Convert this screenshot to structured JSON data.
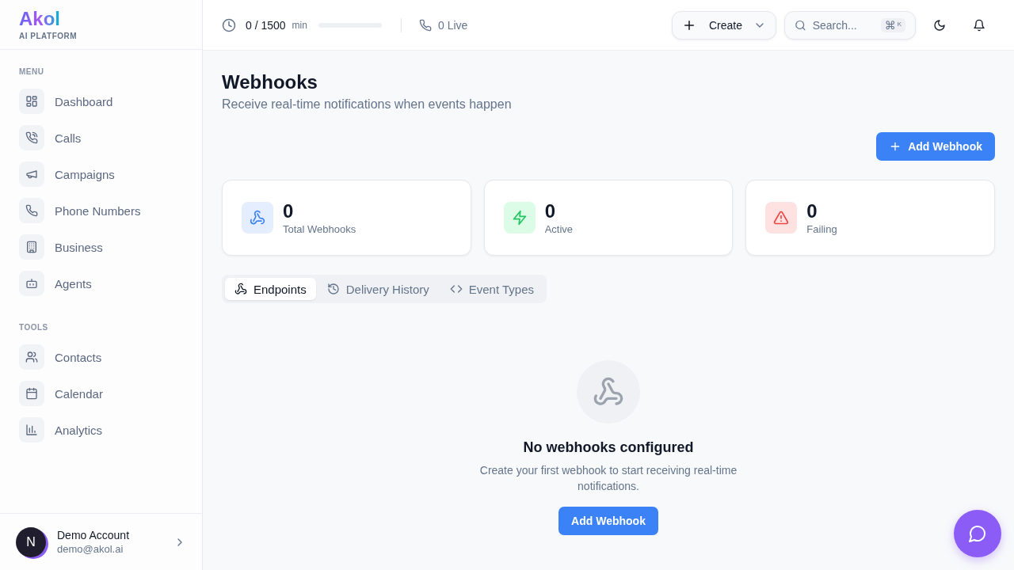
{
  "brand": {
    "name": "Akol",
    "tagline": "AI PLATFORM"
  },
  "header": {
    "usage": {
      "value": "0 / 1500",
      "unit": "min",
      "level": 0
    },
    "live": "0 Live",
    "create_button": "Create",
    "search": {
      "placeholder": "Search...",
      "shortcut_symbol": "⌘",
      "shortcut_key": "K"
    }
  },
  "sidebar": {
    "sections": [
      {
        "heading": "MENU",
        "items": [
          {
            "label": "Dashboard",
            "selected": false
          },
          {
            "label": "Calls",
            "selected": false
          },
          {
            "label": "Campaigns",
            "selected": false
          },
          {
            "label": "Phone Numbers",
            "selected": false
          },
          {
            "label": "Business",
            "selected": false
          },
          {
            "label": "Agents",
            "selected": false
          }
        ]
      },
      {
        "heading": "TOOLS",
        "items": [
          {
            "label": "Contacts",
            "selected": false
          },
          {
            "label": "Calendar",
            "selected": false
          },
          {
            "label": "Analytics",
            "selected": false
          }
        ]
      }
    ],
    "account": {
      "initial": "N",
      "name": "Demo Account",
      "email": "demo@akol.ai"
    }
  },
  "page": {
    "title": "Webhooks",
    "subtitle": "Receive real-time notifications when events happen",
    "add_button": "Add Webhook",
    "stats": [
      {
        "kind": "total",
        "value": "0",
        "label": "Total Webhooks"
      },
      {
        "kind": "active",
        "value": "0",
        "label": "Active"
      },
      {
        "kind": "failing",
        "value": "0",
        "label": "Failing"
      }
    ],
    "tabs": [
      {
        "label": "Endpoints",
        "selected": true
      },
      {
        "label": "Delivery History",
        "selected": false
      },
      {
        "label": "Event Types",
        "selected": false
      }
    ],
    "empty_state": {
      "title": "No webhooks configured",
      "text": "Create your first webhook to start receiving real-time notifications.",
      "button": "Add Webhook"
    }
  }
}
